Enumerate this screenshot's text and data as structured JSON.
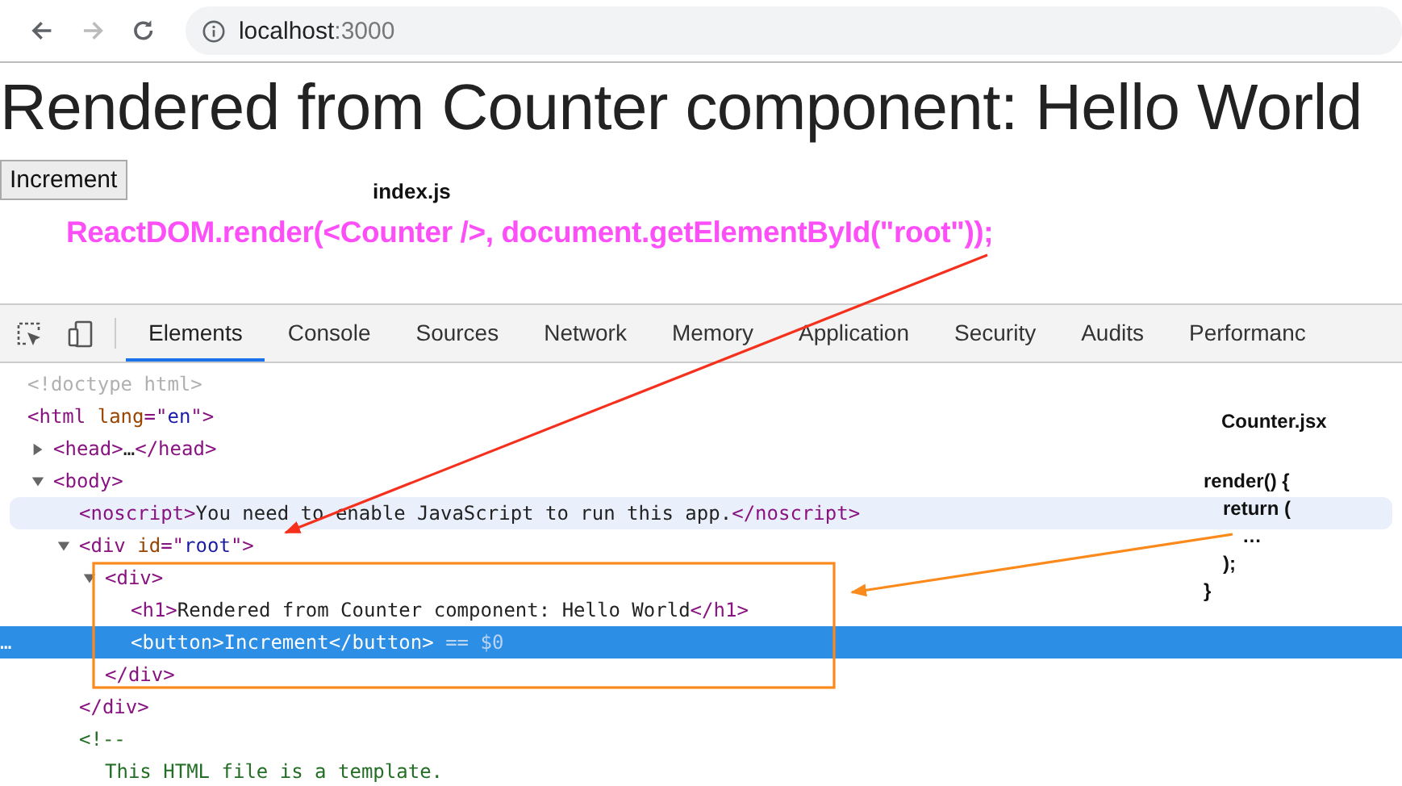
{
  "browser": {
    "url_host": "localhost",
    "url_port": ":3000",
    "forward_disabled": true
  },
  "page": {
    "heading": "Rendered from Counter component: Hello World",
    "button": "Increment"
  },
  "devtools": {
    "tabs": [
      {
        "label": "Elements",
        "selected": true
      },
      {
        "label": "Console",
        "selected": false
      },
      {
        "label": "Sources",
        "selected": false
      },
      {
        "label": "Network",
        "selected": false
      },
      {
        "label": "Memory",
        "selected": false
      },
      {
        "label": "Application",
        "selected": false
      },
      {
        "label": "Security",
        "selected": false
      },
      {
        "label": "Audits",
        "selected": false
      },
      {
        "label": "Performanc",
        "selected": false
      }
    ],
    "dom": [
      {
        "segments": [
          {
            "kind": "doctype",
            "text": "<!doctype html>"
          }
        ]
      },
      {
        "segments": [
          {
            "kind": "tag",
            "text": "<html "
          },
          {
            "kind": "attr",
            "text": "lang"
          },
          {
            "kind": "tag",
            "text": "=\""
          },
          {
            "kind": "value",
            "text": "en"
          },
          {
            "kind": "tag",
            "text": "\">"
          }
        ],
        "children": [
          {
            "expanded": false,
            "segments": [
              {
                "kind": "tag",
                "text": "<head>"
              },
              {
                "kind": "text",
                "text": "…"
              },
              {
                "kind": "tag",
                "text": "</head>"
              }
            ]
          },
          {
            "expanded": true,
            "segments": [
              {
                "kind": "tag",
                "text": "<body>"
              }
            ],
            "children": [
              {
                "hovered": true,
                "segments": [
                  {
                    "kind": "tag",
                    "text": "<noscript>"
                  },
                  {
                    "kind": "text",
                    "text": "You need to enable JavaScript to run this app."
                  },
                  {
                    "kind": "tag",
                    "text": "</noscript>"
                  }
                ]
              },
              {
                "expanded": true,
                "segments": [
                  {
                    "kind": "tag",
                    "text": "<div "
                  },
                  {
                    "kind": "attr",
                    "text": "id"
                  },
                  {
                    "kind": "tag",
                    "text": "=\""
                  },
                  {
                    "kind": "value",
                    "text": "root"
                  },
                  {
                    "kind": "tag",
                    "text": "\">"
                  }
                ],
                "children": [
                  {
                    "expanded": true,
                    "segments": [
                      {
                        "kind": "tag",
                        "text": "<div>"
                      }
                    ],
                    "children": [
                      {
                        "segments": [
                          {
                            "kind": "tag",
                            "text": "<h1>"
                          },
                          {
                            "kind": "text",
                            "text": "Rendered from Counter component: Hello World"
                          },
                          {
                            "kind": "tag",
                            "text": "</h1>"
                          }
                        ]
                      },
                      {
                        "selected": true,
                        "marker": "…",
                        "segments": [
                          {
                            "kind": "tag",
                            "text": "<button>"
                          },
                          {
                            "kind": "text",
                            "text": "Increment"
                          },
                          {
                            "kind": "tag",
                            "text": "</button>"
                          },
                          {
                            "kind": "ref",
                            "text": " == $0"
                          }
                        ]
                      }
                    ],
                    "closing": [
                      {
                        "kind": "tag",
                        "text": "</div>"
                      }
                    ]
                  }
                ],
                "closing": [
                  {
                    "kind": "tag",
                    "text": "</div>"
                  }
                ]
              },
              {
                "segments": [
                  {
                    "kind": "comment",
                    "text": "<!--"
                  }
                ],
                "children": [
                  {
                    "segments": [
                      {
                        "kind": "comment",
                        "text": "This HTML file is a template."
                      }
                    ]
                  }
                ]
              }
            ]
          }
        ]
      }
    ]
  },
  "annotations": {
    "index_label": "index.js",
    "index_code": "ReactDOM.render(<Counter />, document.getElementById(\"root\"));",
    "counter_label": "Counter.jsx",
    "counter_code": [
      "render() {",
      "  return (",
      "    …",
      "  );",
      "}"
    ]
  }
}
